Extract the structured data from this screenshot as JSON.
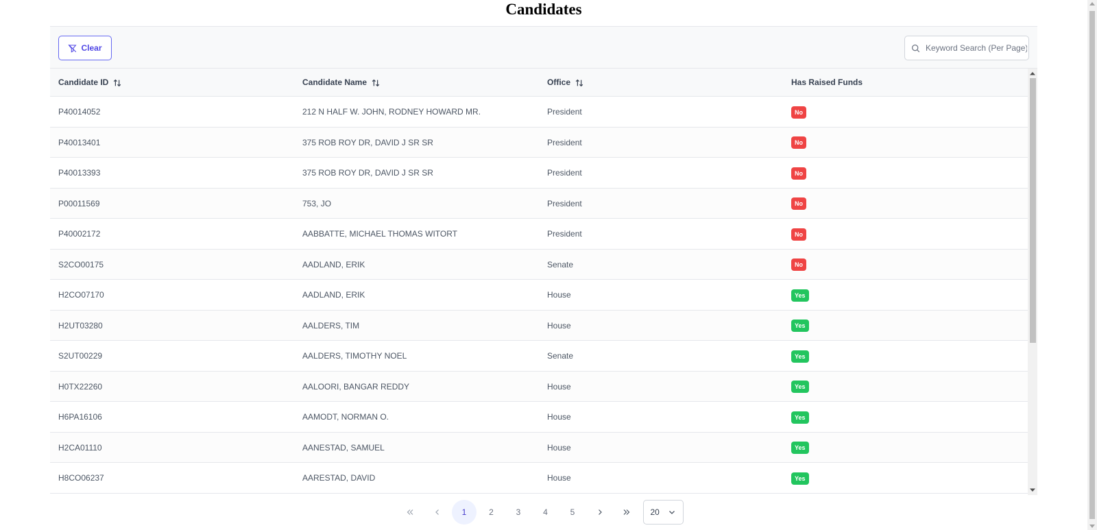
{
  "page": {
    "title": "Candidates"
  },
  "toolbar": {
    "clear_label": "Clear",
    "clear_icon": "filter-slash-icon",
    "search_placeholder": "Keyword Search (Per Page)",
    "search_value": ""
  },
  "columns": [
    {
      "label": "Candidate ID",
      "sortable": true
    },
    {
      "label": "Candidate Name",
      "sortable": true
    },
    {
      "label": "Office",
      "sortable": true
    },
    {
      "label": "Has Raised Funds",
      "sortable": false
    }
  ],
  "rows": [
    {
      "id": "P40014052",
      "name": "212 N HALF W. JOHN, RODNEY HOWARD MR.",
      "office": "President",
      "funds": "No"
    },
    {
      "id": "P40013401",
      "name": "375 ROB ROY DR, DAVID J SR SR",
      "office": "President",
      "funds": "No"
    },
    {
      "id": "P40013393",
      "name": "375 ROB ROY DR, DAVID J SR SR",
      "office": "President",
      "funds": "No"
    },
    {
      "id": "P00011569",
      "name": "753, JO",
      "office": "President",
      "funds": "No"
    },
    {
      "id": "P40002172",
      "name": "AABBATTE, MICHAEL THOMAS WITORT",
      "office": "President",
      "funds": "No"
    },
    {
      "id": "S2CO00175",
      "name": "AADLAND, ERIK",
      "office": "Senate",
      "funds": "No"
    },
    {
      "id": "H2CO07170",
      "name": "AADLAND, ERIK",
      "office": "House",
      "funds": "Yes"
    },
    {
      "id": "H2UT03280",
      "name": "AALDERS, TIM",
      "office": "House",
      "funds": "Yes"
    },
    {
      "id": "S2UT00229",
      "name": "AALDERS, TIMOTHY NOEL",
      "office": "Senate",
      "funds": "Yes"
    },
    {
      "id": "H0TX22260",
      "name": "AALOORI, BANGAR REDDY",
      "office": "House",
      "funds": "Yes"
    },
    {
      "id": "H6PA16106",
      "name": "AAMODT, NORMAN O.",
      "office": "House",
      "funds": "Yes"
    },
    {
      "id": "H2CA01110",
      "name": "AANESTAD, SAMUEL",
      "office": "House",
      "funds": "Yes"
    },
    {
      "id": "H8CO06237",
      "name": "AARESTAD, DAVID",
      "office": "House",
      "funds": "Yes"
    }
  ],
  "pagination": {
    "pages": [
      "1",
      "2",
      "3",
      "4",
      "5"
    ],
    "current": "1",
    "rows_per_page": "20"
  },
  "colors": {
    "no_badge": "#ef4444",
    "yes_badge": "#22c55e",
    "accent": "#4f46e5"
  }
}
